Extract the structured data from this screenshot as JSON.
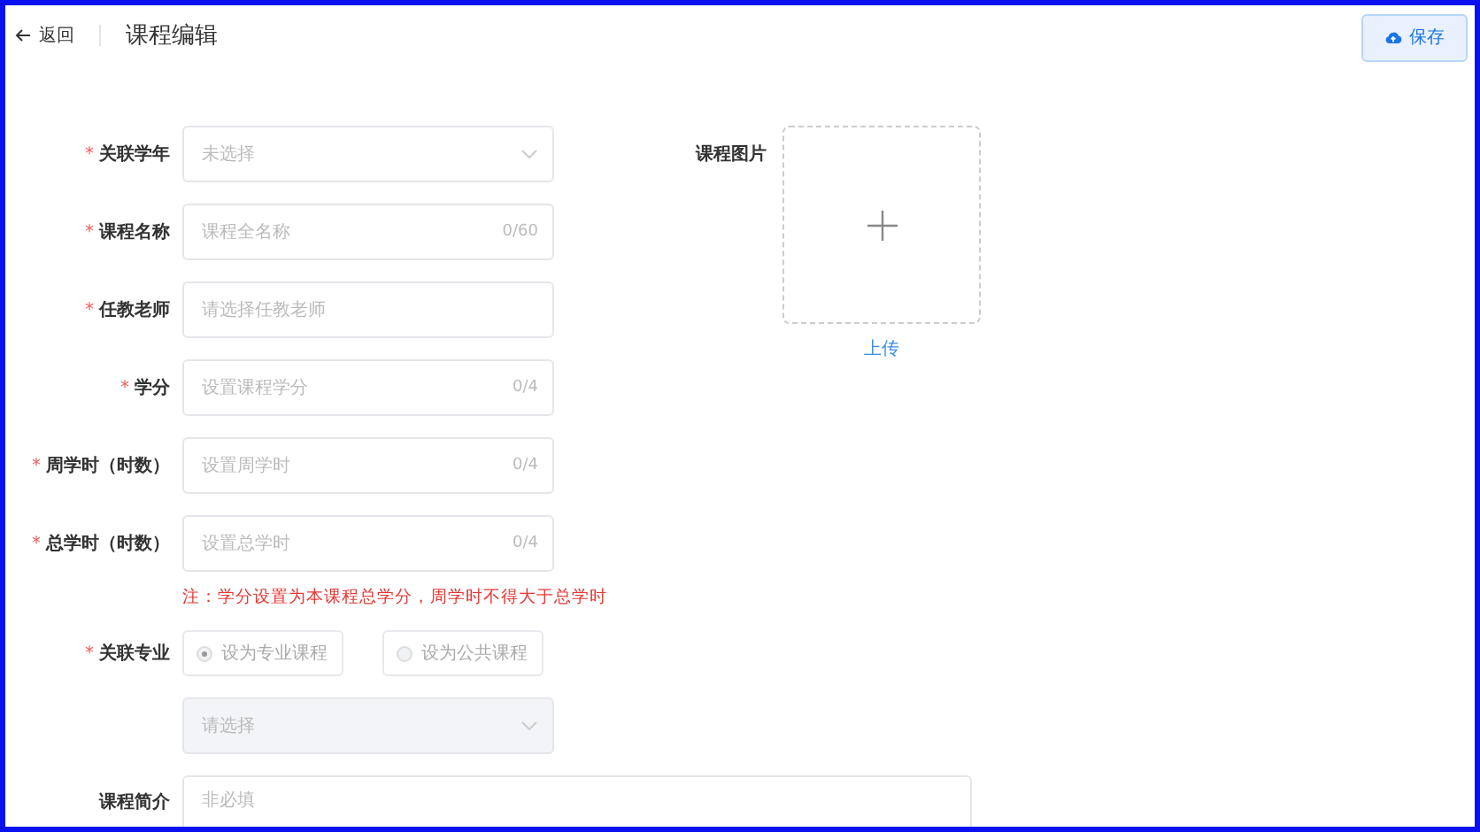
{
  "header": {
    "back": "返回",
    "title": "课程编辑",
    "save": "保存"
  },
  "fields": [
    {
      "kind": "select",
      "label": "关联学年",
      "required_mark": "*",
      "placeholder": "未选择",
      "disabled": false
    },
    {
      "kind": "input",
      "label": "课程名称",
      "required_mark": "*",
      "placeholder": "课程全名称",
      "counter": "0/60"
    },
    {
      "kind": "input",
      "label": "任教老师",
      "required_mark": "*",
      "placeholder": "请选择任教老师"
    },
    {
      "kind": "input",
      "label": "学分",
      "required_mark": "*",
      "placeholder": "设置课程学分",
      "counter": "0/4"
    },
    {
      "kind": "input",
      "label": "周学时（时数）",
      "required_mark": "*",
      "placeholder": "设置周学时",
      "counter": "0/4"
    },
    {
      "kind": "input",
      "label": "总学时（时数）",
      "required_mark": "*",
      "placeholder": "设置总学时",
      "counter": "0/4"
    },
    {
      "kind": "note",
      "text": "注：学分设置为本课程总学分，周学时不得大于总学时"
    },
    {
      "kind": "radio",
      "label": "关联专业",
      "required_mark": "*",
      "disabled": true,
      "options": [
        {
          "label": "设为专业课程",
          "selected": true
        },
        {
          "label": "设为公共课程",
          "selected": false
        }
      ]
    },
    {
      "kind": "select",
      "placeholder": "请选择",
      "disabled": true
    },
    {
      "kind": "textarea",
      "label": "课程简介",
      "placeholder": "非必填"
    }
  ],
  "image": {
    "label": "课程图片",
    "upload": "上传"
  }
}
